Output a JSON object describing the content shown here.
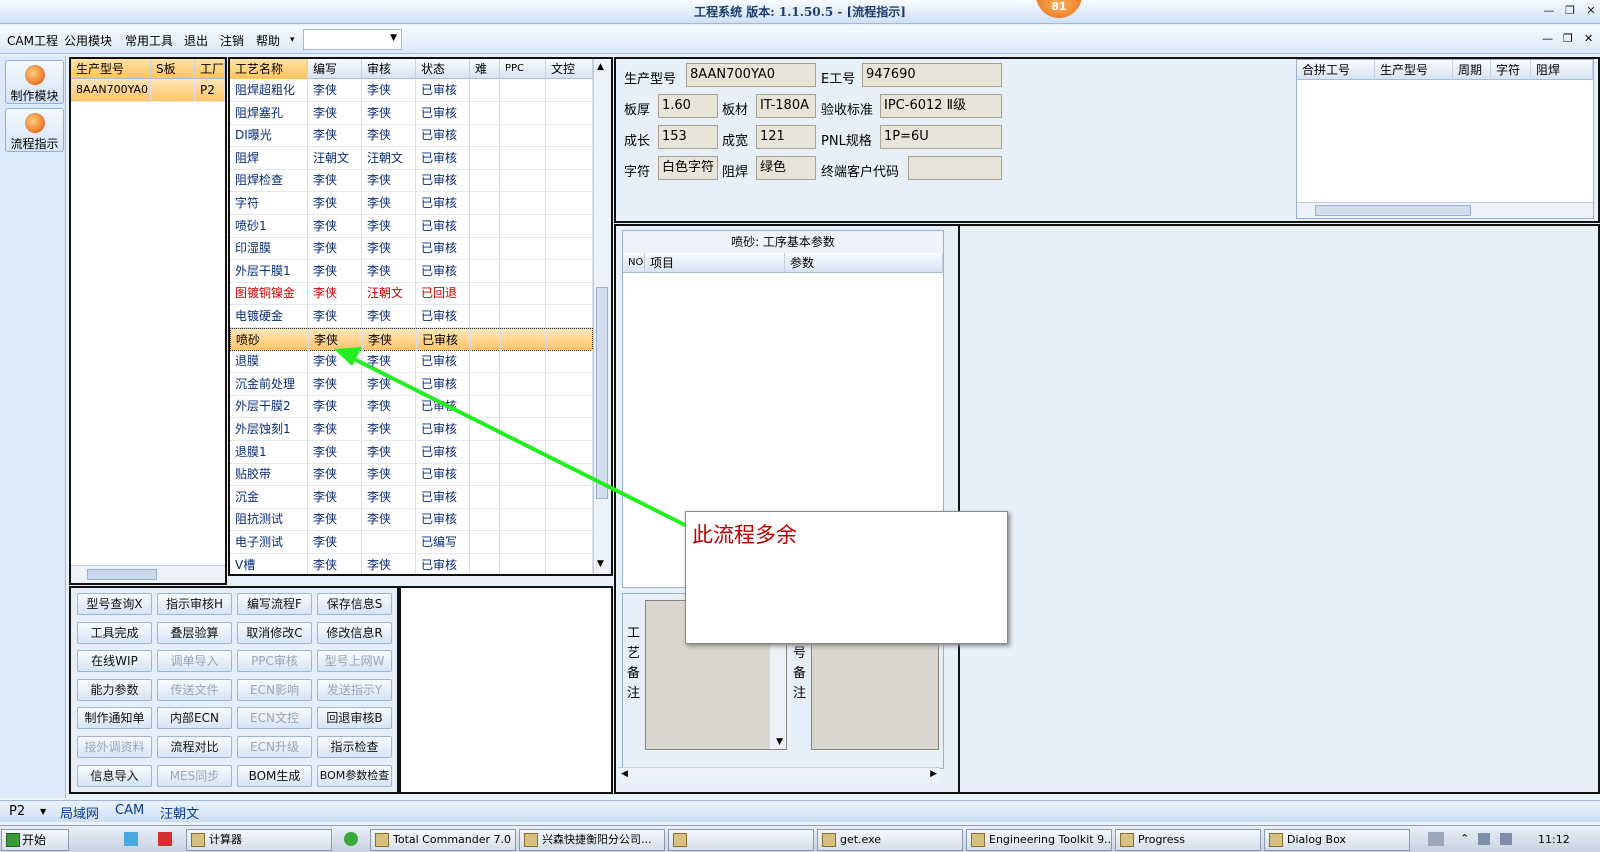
{
  "window": {
    "title": "工程系统  版本: 1.1.50.5 - [流程指示]",
    "badge": "81"
  },
  "menu": {
    "items": [
      "CAM工程",
      "公用模块",
      "常用工具",
      "退出",
      "注销",
      "帮助"
    ],
    "dropdown_arrow": "▾"
  },
  "sidebar": {
    "buttons": [
      {
        "label": "制作模块",
        "icon": "fire-icon"
      },
      {
        "label": "流程指示",
        "icon": "flow-icon"
      }
    ]
  },
  "model_list": {
    "headers": [
      "生产型号",
      "S板",
      "工厂"
    ],
    "rows": [
      [
        "8AAN700YA0",
        "",
        "P2"
      ]
    ]
  },
  "process_grid": {
    "headers": [
      "工艺名称",
      "编写",
      "审核",
      "状态",
      "难",
      "PPC",
      "文控"
    ],
    "rows": [
      {
        "name": "阻焊超粗化",
        "writer": "李侠",
        "reviewer": "李侠",
        "status": "已审核"
      },
      {
        "name": "阻焊塞孔",
        "writer": "李侠",
        "reviewer": "李侠",
        "status": "已审核"
      },
      {
        "name": "DI曝光",
        "writer": "李侠",
        "reviewer": "李侠",
        "status": "已审核"
      },
      {
        "name": "阻焊",
        "writer": "汪朝文",
        "reviewer": "汪朝文",
        "status": "已审核"
      },
      {
        "name": "阻焊检查",
        "writer": "李侠",
        "reviewer": "李侠",
        "status": "已审核"
      },
      {
        "name": "字符",
        "writer": "李侠",
        "reviewer": "李侠",
        "status": "已审核"
      },
      {
        "name": "喷砂1",
        "writer": "李侠",
        "reviewer": "李侠",
        "status": "已审核"
      },
      {
        "name": "印湿膜",
        "writer": "李侠",
        "reviewer": "李侠",
        "status": "已审核"
      },
      {
        "name": "外层干膜1",
        "writer": "李侠",
        "reviewer": "李侠",
        "status": "已审核"
      },
      {
        "name": "图镀铜镍金",
        "writer": "李侠",
        "reviewer": "汪朝文",
        "status": "已回退",
        "red": true
      },
      {
        "name": "电镀硬金",
        "writer": "李侠",
        "reviewer": "李侠",
        "status": "已审核"
      },
      {
        "name": "喷砂",
        "writer": "李侠",
        "reviewer": "李侠",
        "status": "已审核",
        "selected": true
      },
      {
        "name": "退膜",
        "writer": "李侠",
        "reviewer": "李侠",
        "status": "已审核"
      },
      {
        "name": "沉金前处理",
        "writer": "李侠",
        "reviewer": "李侠",
        "status": "已审核"
      },
      {
        "name": "外层干膜2",
        "writer": "李侠",
        "reviewer": "李侠",
        "status": "已审核"
      },
      {
        "name": "外层蚀刻1",
        "writer": "李侠",
        "reviewer": "李侠",
        "status": "已审核"
      },
      {
        "name": "退膜1",
        "writer": "李侠",
        "reviewer": "李侠",
        "status": "已审核"
      },
      {
        "name": "贴胶带",
        "writer": "李侠",
        "reviewer": "李侠",
        "status": "已审核"
      },
      {
        "name": "沉金",
        "writer": "李侠",
        "reviewer": "李侠",
        "status": "已审核"
      },
      {
        "name": "阻抗测试",
        "writer": "李侠",
        "reviewer": "李侠",
        "status": "已审核"
      },
      {
        "name": "电子测试",
        "writer": "李侠",
        "reviewer": "",
        "status": "已编写"
      },
      {
        "name": "V槽",
        "writer": "李侠",
        "reviewer": "李侠",
        "status": "已审核"
      }
    ]
  },
  "actions": {
    "buttons": [
      {
        "label": "型号查询X",
        "enabled": true
      },
      {
        "label": "指示审核H",
        "enabled": true
      },
      {
        "label": "编写流程F",
        "enabled": true
      },
      {
        "label": "保存信息S",
        "enabled": true
      },
      {
        "label": "工具完成",
        "enabled": true
      },
      {
        "label": "叠层验算",
        "enabled": true
      },
      {
        "label": "取消修改C",
        "enabled": true
      },
      {
        "label": "修改信息R",
        "enabled": true
      },
      {
        "label": "在线WIP",
        "enabled": true
      },
      {
        "label": "调单导入",
        "enabled": false
      },
      {
        "label": "PPC审核",
        "enabled": false
      },
      {
        "label": "型号上网W",
        "enabled": false
      },
      {
        "label": "能力参数",
        "enabled": true
      },
      {
        "label": "传送文件",
        "enabled": false
      },
      {
        "label": "ECN影响",
        "enabled": false
      },
      {
        "label": "发送指示Y",
        "enabled": false
      },
      {
        "label": "制作通知单",
        "enabled": true
      },
      {
        "label": "内部ECN",
        "enabled": true
      },
      {
        "label": "ECN文控",
        "enabled": false
      },
      {
        "label": "回退审核B",
        "enabled": true
      },
      {
        "label": "接外调资料",
        "enabled": false
      },
      {
        "label": "流程对比",
        "enabled": true
      },
      {
        "label": "ECN升级",
        "enabled": false
      },
      {
        "label": "指示检查",
        "enabled": true
      },
      {
        "label": "信息导入",
        "enabled": true
      },
      {
        "label": "MES同步",
        "enabled": false
      },
      {
        "label": "BOM生成",
        "enabled": true
      },
      {
        "label": "BOM参数检查",
        "enabled": true
      }
    ]
  },
  "info": {
    "model_label": "生产型号",
    "model_value": "8AAN700YA0",
    "eno_label": "E工号",
    "eno_value": "947690",
    "thickness_label": "板厚",
    "thickness_value": "1.60",
    "material_label": "板材",
    "material_value": "IT-180A",
    "standard_label": "验收标准",
    "standard_value": "IPC-6012 Ⅱ级",
    "length_label": "成长",
    "length_value": "153",
    "width_label": "成宽",
    "width_value": "121",
    "pnl_label": "PNL规格",
    "pnl_value": "1P=6U",
    "char_label": "字符",
    "char_value": "白色字符",
    "mask_label": "阻焊",
    "mask_value": "绿色",
    "customer_label": "终端客户代码",
    "customer_value": ""
  },
  "merge_grid": {
    "headers": [
      "合拼工号",
      "生产型号",
      "周期",
      "字符",
      "阻焊"
    ]
  },
  "params": {
    "title": "喷砂: 工序基本参数",
    "headers": [
      "NO",
      "项目",
      "参数"
    ]
  },
  "remarks": {
    "process_label": "工艺备注",
    "model_label": "号备注"
  },
  "annotation": {
    "text": "此流程多余",
    "arrow_color": "#22ee22"
  },
  "statusbar": {
    "factory": "P2",
    "items": [
      "局域网",
      "CAM",
      "汪朝文"
    ]
  },
  "taskbar": {
    "start": "开始",
    "tasks": [
      "计算器",
      "Total Commander 7.0 ...",
      "兴森快捷衡阳分公司...",
      "",
      "get.exe",
      "Engineering Toolkit 9....",
      "Progress",
      "Dialog Box"
    ],
    "clock": "11:12"
  }
}
